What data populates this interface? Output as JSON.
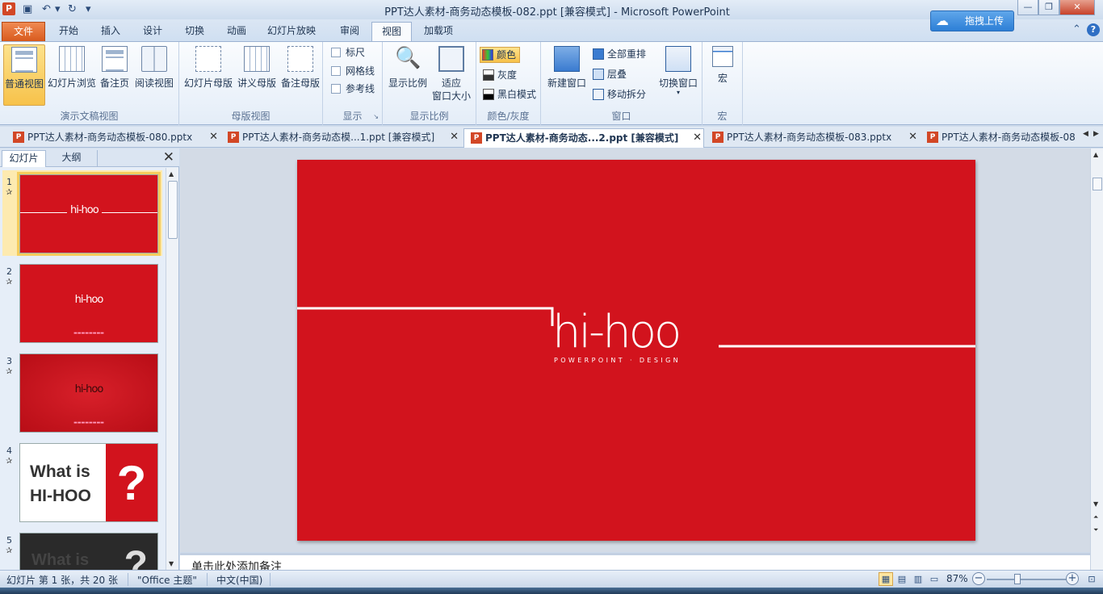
{
  "window": {
    "title": "PPT达人素材-商务动态模板-082.ppt [兼容模式]  -  Microsoft PowerPoint",
    "app_icon_letter": "P",
    "cloud_upload_label": "拖拽上传"
  },
  "quick_access": {
    "save_icon": "save-icon",
    "undo_icon": "undo-icon",
    "redo_icon": "redo-icon"
  },
  "ribbon_tabs": [
    "文件",
    "开始",
    "插入",
    "设计",
    "切换",
    "动画",
    "幻灯片放映",
    "审阅",
    "视图",
    "加载项"
  ],
  "active_ribbon_tab": "视图",
  "ribbon": {
    "presentation_views": {
      "label": "演示文稿视图",
      "buttons": [
        "普通视图",
        "幻灯片浏览",
        "备注页",
        "阅读视图"
      ]
    },
    "master_views": {
      "label": "母版视图",
      "buttons": [
        "幻灯片母版",
        "讲义母版",
        "备注母版"
      ]
    },
    "show": {
      "label": "显示",
      "checkboxes": [
        "标尺",
        "网格线",
        "参考线"
      ]
    },
    "zoom": {
      "label": "显示比例",
      "buttons": [
        "显示比例",
        "适应",
        "窗口大小"
      ]
    },
    "color": {
      "label": "颜色/灰度",
      "buttons": [
        "颜色",
        "灰度",
        "黑白模式"
      ]
    },
    "window": {
      "label": "窗口",
      "new_window": "新建窗口",
      "small": [
        "全部重排",
        "层叠",
        "移动拆分"
      ],
      "switch": "切换窗口"
    },
    "macros": {
      "label": "宏",
      "button": "宏"
    }
  },
  "doc_tabs": [
    {
      "label": "PPT达人素材-商务动态模板-080.pptx",
      "active": false
    },
    {
      "label": "PPT达人素材-商务动态模...1.ppt [兼容模式]",
      "active": false
    },
    {
      "label": "PPT达人素材-商务动态...2.ppt [兼容模式]",
      "active": true
    },
    {
      "label": "PPT达人素材-商务动态模板-083.pptx",
      "active": false
    },
    {
      "label": "PPT达人素材-商务动态模板-08",
      "active": false
    }
  ],
  "left_pane": {
    "tabs": [
      "幻灯片",
      "大纲"
    ],
    "slides": [
      {
        "num": "1",
        "logo": "hi-hoo"
      },
      {
        "num": "2",
        "logo": "hi-hoo"
      },
      {
        "num": "3",
        "logo": "hi-hoo"
      },
      {
        "num": "4",
        "text_line1": "What is",
        "text_line2": "HI-HOO",
        "mark": "?"
      },
      {
        "num": "5",
        "text_line1": "What is",
        "mark": "?"
      }
    ]
  },
  "slide": {
    "logo": "hi-hoo",
    "subtitle": "POWERPOINT · DESIGN",
    "background": "#d2131d"
  },
  "notes": {
    "placeholder": "单击此处添加备注"
  },
  "status": {
    "slide_info": "幻灯片 第 1 张，共 20 张",
    "theme": "\"Office 主题\"",
    "language": "中文(中国)",
    "zoom": "87%",
    "zoom_fraction": 0.38
  }
}
